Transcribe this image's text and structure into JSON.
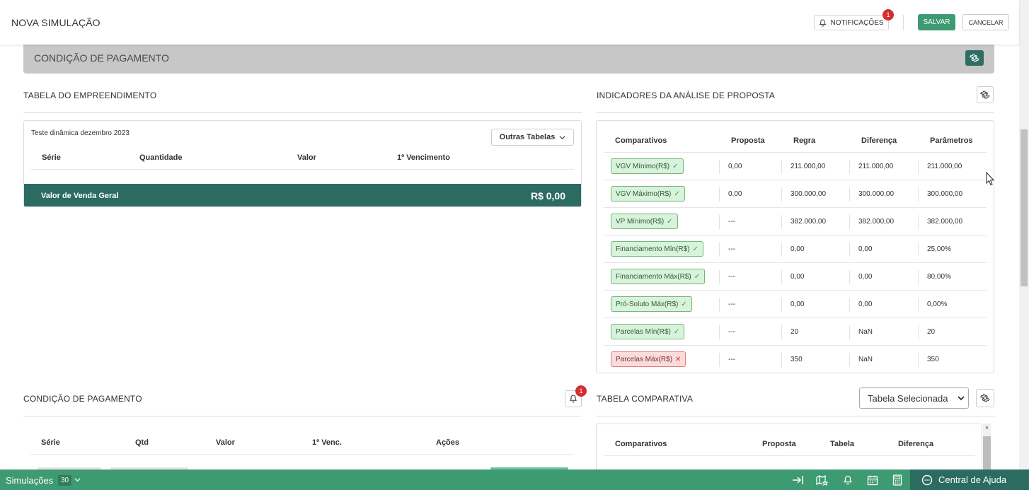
{
  "header": {
    "title": "NOVA SIMULAÇÃO",
    "notifications_label": "NOTIFICAÇÕES",
    "notifications_badge": "1",
    "save_label": "SALVAR",
    "cancel_label": "CANCELAR"
  },
  "condition_bar": {
    "label": "CONDIÇÃO DE PAGAMENTO"
  },
  "empreendimento": {
    "title": "TABELA DO EMPREENDIMENTO",
    "table_name": "Teste dinâmica dezembro 2023",
    "other_tables_label": "Outras Tabelas",
    "columns": [
      "Série",
      "Quantidade",
      "Valor",
      "1º Vencimento"
    ],
    "total_label": "Valor de Venda Geral",
    "total_value": "R$ 0,00"
  },
  "indicators": {
    "title": "INDICADORES DA ANÁLISE DE PROPOSTA",
    "columns": [
      "Comparativos",
      "Proposta",
      "Regra",
      "Diferença",
      "Parâmetros"
    ],
    "rows": [
      {
        "label": "VGV Mínimo(R$)",
        "status": "ok",
        "mark": "✓",
        "proposta": "0,00",
        "regra": "211.000,00",
        "diferenca": "211.000,00",
        "parametros": "211.000,00"
      },
      {
        "label": "VGV Máximo(R$)",
        "status": "ok",
        "mark": "✓",
        "proposta": "0,00",
        "regra": "300.000,00",
        "diferenca": "300.000,00",
        "parametros": "300.000,00"
      },
      {
        "label": "VP Mínimo(R$)",
        "status": "ok",
        "mark": "✓",
        "proposta": "---",
        "regra": "382.000,00",
        "diferenca": "382.000,00",
        "parametros": "382.000,00"
      },
      {
        "label": "Financiamento Mín(R$)",
        "status": "ok",
        "mark": "✓",
        "proposta": "---",
        "regra": "0,00",
        "diferenca": "0,00",
        "parametros": "25,00%"
      },
      {
        "label": "Financiamento Máx(R$)",
        "status": "ok",
        "mark": "✓",
        "proposta": "---",
        "regra": "0,00",
        "diferenca": "0,00",
        "parametros": "80,00%"
      },
      {
        "label": "Pró-Soluto Máx(R$)",
        "status": "ok",
        "mark": "✓",
        "proposta": "---",
        "regra": "0,00",
        "diferenca": "0,00",
        "parametros": "0,00%"
      },
      {
        "label": "Parcelas Mín(R$)",
        "status": "ok",
        "mark": "✓",
        "proposta": "---",
        "regra": "20",
        "diferenca": "NaN",
        "parametros": "20"
      },
      {
        "label": "Parcelas Máx(R$)",
        "status": "bad",
        "mark": "✕",
        "proposta": "---",
        "regra": "350",
        "diferenca": "NaN",
        "parametros": "350"
      }
    ]
  },
  "payment": {
    "title": "CONDIÇÃO DE PAGAMENTO",
    "badge": "1",
    "columns": [
      "Série",
      "Qtd",
      "Valor",
      "1º Venc.",
      "Ações"
    ]
  },
  "comparative": {
    "title": "TABELA COMPARATIVA",
    "selected": "Tabela Selecionada",
    "columns": [
      "Comparativos",
      "Proposta",
      "Tabela",
      "Diferença"
    ]
  },
  "bottombar": {
    "simulations_label": "Simulações",
    "simulations_count": "30",
    "help_label": "Central de Ajuda"
  },
  "colors": {
    "accent": "#3e9a72",
    "dark": "#2c6b62",
    "ok_bg": "#d9f2dc",
    "bad_bg": "#fbdcdc",
    "badge": "#d32f2f"
  }
}
